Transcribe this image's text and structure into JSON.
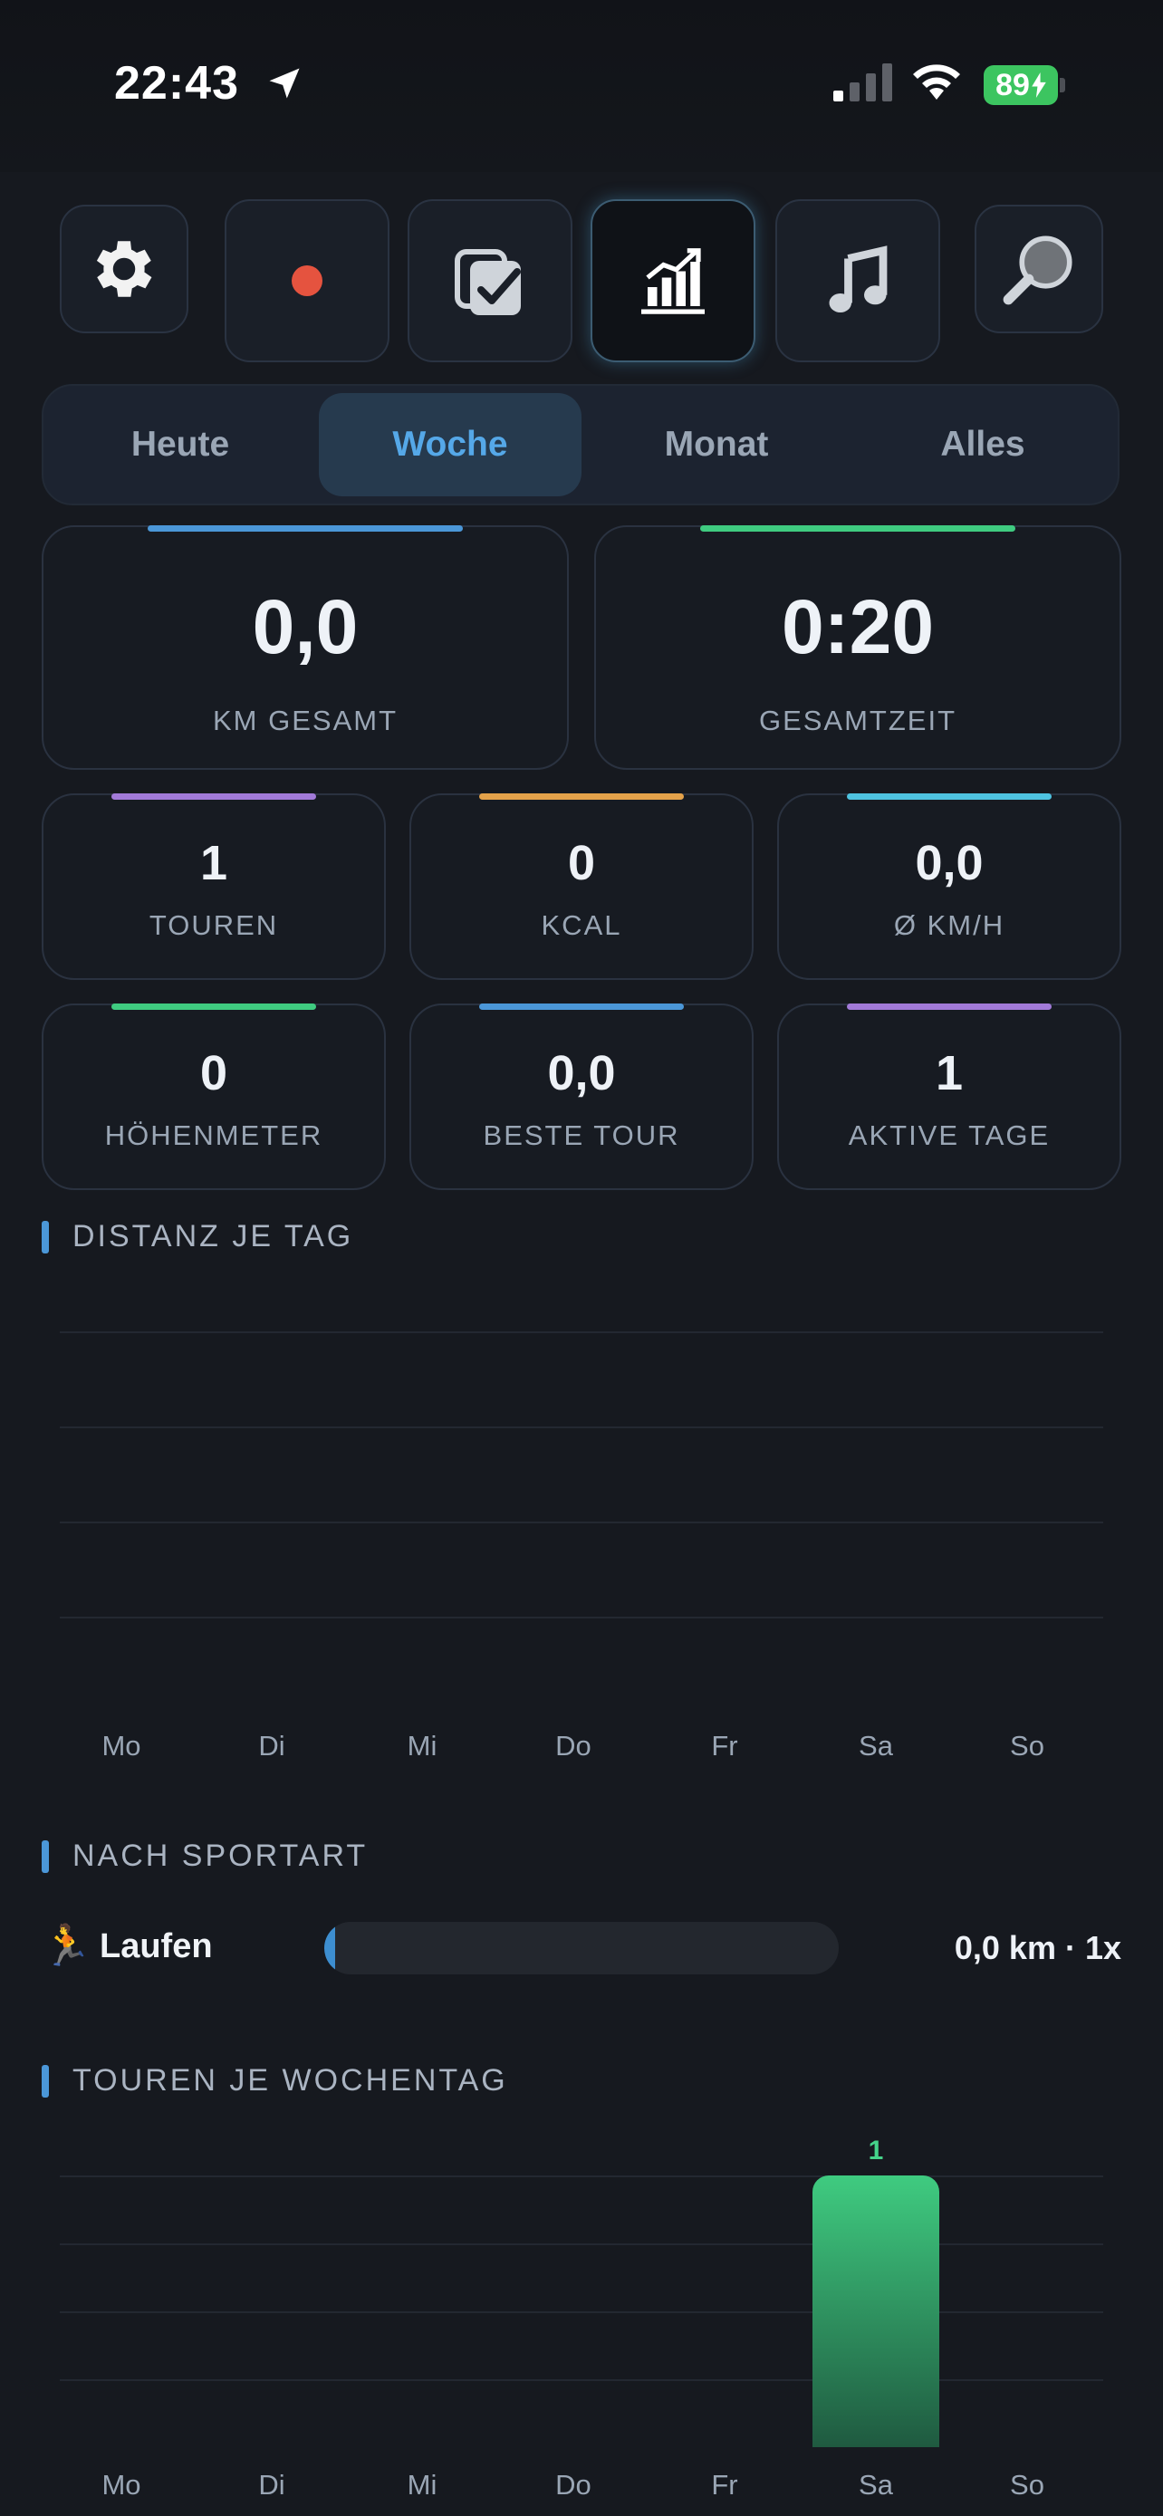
{
  "status_bar": {
    "time": "22:43",
    "battery": "89"
  },
  "toolbar": {
    "buttons": [
      {
        "icon": "gear-icon"
      },
      {
        "icon": "record-dot-icon"
      },
      {
        "icon": "checklist-icon"
      },
      {
        "icon": "stats-chart-icon",
        "active": true
      },
      {
        "icon": "music-note-icon"
      },
      {
        "icon": "search-icon"
      }
    ]
  },
  "tabs": [
    {
      "label": "Heute"
    },
    {
      "label": "Woche",
      "active": true
    },
    {
      "label": "Monat"
    },
    {
      "label": "Alles"
    }
  ],
  "stats": {
    "km_total": {
      "value": "0,0",
      "label": "KM GESAMT"
    },
    "total_time": {
      "value": "0:20",
      "label": "GESAMTZEIT"
    },
    "tours": {
      "value": "1",
      "label": "TOUREN"
    },
    "kcal": {
      "value": "0",
      "label": "KCAL"
    },
    "avg_speed": {
      "value": "0,0",
      "label": "Ø KM/H"
    },
    "elevation": {
      "value": "0",
      "label": "HÖHENMETER"
    },
    "best_tour": {
      "value": "0,0",
      "label": "BESTE TOUR"
    },
    "active_days": {
      "value": "1",
      "label": "AKTIVE TAGE"
    }
  },
  "colors": {
    "blue": "#4b97d8",
    "green": "#3fcb80",
    "purple": "#a27ad8",
    "orange": "#e4a24a",
    "cyan": "#4ec3e0"
  },
  "sections": {
    "distance_per_day": "DISTANZ JE TAG",
    "by_sport": "NACH SPORTART",
    "tours_per_weekday": "TOUREN JE WOCHENTAG"
  },
  "sport": {
    "icon": "🏃",
    "name": "Laufen",
    "stat": "0,0 km · 1x",
    "fraction": 0
  },
  "chart_data": [
    {
      "type": "bar",
      "title": "DISTANZ JE TAG",
      "categories": [
        "Mo",
        "Di",
        "Mi",
        "Do",
        "Fr",
        "Sa",
        "So"
      ],
      "values": [
        0,
        0,
        0,
        0,
        0,
        0,
        0
      ],
      "grid": true
    },
    {
      "type": "bar",
      "title": "TOUREN JE WOCHENTAG",
      "categories": [
        "Mo",
        "Di",
        "Mi",
        "Do",
        "Fr",
        "Sa",
        "So"
      ],
      "values": [
        0,
        0,
        0,
        0,
        0,
        1,
        0
      ],
      "ylim": [
        0,
        1
      ],
      "grid": true
    }
  ]
}
